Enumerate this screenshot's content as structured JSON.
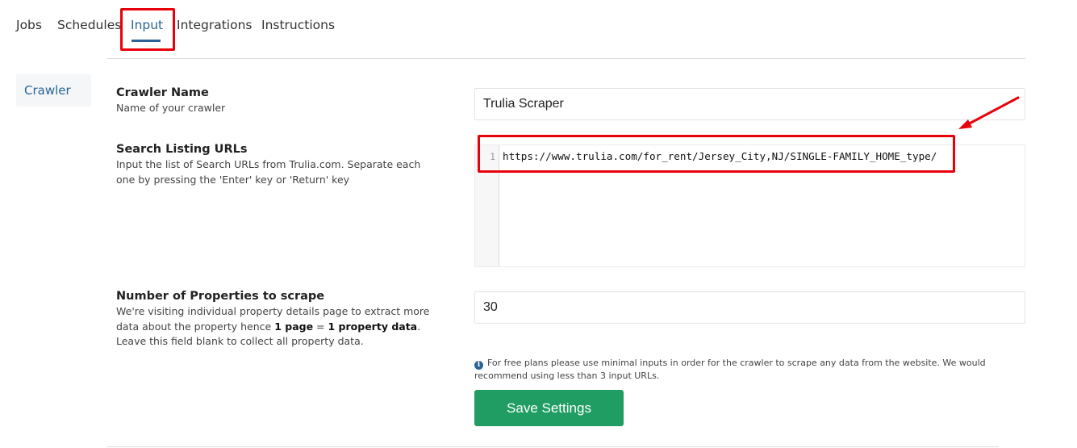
{
  "tabs": [
    {
      "label": "Jobs"
    },
    {
      "label": "Schedules"
    },
    {
      "label": "Input"
    },
    {
      "label": "Integrations"
    },
    {
      "label": "Instructions"
    }
  ],
  "active_tab": "Input",
  "sidebar": {
    "items": [
      {
        "label": "Crawler"
      }
    ]
  },
  "form": {
    "crawler_name": {
      "title": "Crawler Name",
      "description": "Name of your crawler",
      "value": "Trulia Scraper"
    },
    "search_urls": {
      "title": "Search Listing URLs",
      "description": "Input the list of Search URLs from Trulia.com. Separate each one by pressing the 'Enter' key or 'Return' key",
      "line_number": "1",
      "value": "https://www.trulia.com/for_rent/Jersey_City,NJ/SINGLE-FAMILY_HOME_type/"
    },
    "num_properties": {
      "title": "Number of Properties to scrape",
      "description_before": "We're visiting individual property details page to extract more data about the property hence ",
      "bold_1": "1 page",
      "description_mid": " = ",
      "bold_2": "1 property data",
      "description_after": ". Leave this field blank to collect all property data.",
      "value": "30"
    },
    "info_note": "For free plans please use minimal inputs in order for the crawler to scrape any data from the website. We would recommend using less than 3 input URLs.",
    "save_label": "Save Settings"
  },
  "colors": {
    "accent": "#2a6496",
    "save_button": "#1f9d63",
    "annotation": "#e8000b"
  },
  "icons": [
    "info-icon",
    "annotation-arrow-icon"
  ]
}
